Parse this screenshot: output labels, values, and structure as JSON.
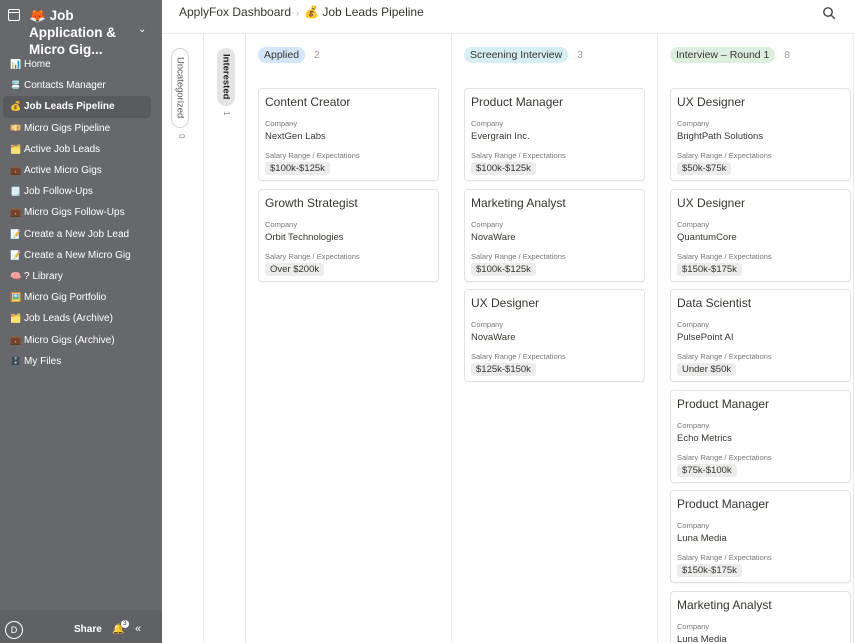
{
  "sidebar": {
    "title_icon": "🦊",
    "title": "Job Application & Micro Gig...",
    "items": [
      {
        "emoji": "📊",
        "label": "Home"
      },
      {
        "emoji": "📇",
        "label": "Contacts Manager"
      },
      {
        "emoji": "💰",
        "label": "Job Leads Pipeline"
      },
      {
        "emoji": "💴",
        "label": "Micro Gigs Pipeline"
      },
      {
        "emoji": "🗂️",
        "label": "Active Job Leads"
      },
      {
        "emoji": "💼",
        "label": "Active Micro Gigs"
      },
      {
        "emoji": "🗒️",
        "label": "Job Follow-Ups"
      },
      {
        "emoji": "💼",
        "label": "Micro Gigs Follow-Ups"
      },
      {
        "emoji": "📝",
        "label": "Create a New Job Lead"
      },
      {
        "emoji": "📝",
        "label": "Create a New Micro Gig"
      },
      {
        "emoji": "🧠",
        "label": "? Library"
      },
      {
        "emoji": "🖼️",
        "label": "Micro Gig Portfolio"
      },
      {
        "emoji": "🗂️",
        "label": "Job Leads (Archive)"
      },
      {
        "emoji": "💼",
        "label": "Micro Gigs (Archive)"
      },
      {
        "emoji": "🗄️",
        "label": "My Files"
      }
    ],
    "footer": {
      "avatar": "D",
      "share": "Share",
      "notifications": "3"
    }
  },
  "topbar": {
    "breadcrumb_root": "ApplyFox Dashboard",
    "breadcrumb_icon": "💰",
    "breadcrumb_current": "Job Leads Pipeline"
  },
  "collapsed_columns": [
    {
      "label": "Uncategorized",
      "count": "0"
    },
    {
      "label": "Interested",
      "count": "1"
    }
  ],
  "columns": [
    {
      "label": "Applied",
      "count": "2",
      "color": "#d3e5fb",
      "cards": [
        {
          "title": "Content Creator",
          "company_label": "Company",
          "company": "NextGen Labs",
          "salary_label": "Salary Range / Expectations",
          "salary": "$100k-$125k"
        },
        {
          "title": "Growth Strategist",
          "company_label": "Company",
          "company": "Orbit Technologies",
          "salary_label": "Salary Range / Expectations",
          "salary": "Over $200k"
        }
      ]
    },
    {
      "label": "Screening Interview",
      "count": "3",
      "color": "#d5eef3",
      "cards": [
        {
          "title": "Product Manager",
          "company_label": "Company",
          "company": "Evergrain Inc.",
          "salary_label": "Salary Range / Expectations",
          "salary": "$100k-$125k"
        },
        {
          "title": "Marketing Analyst",
          "company_label": "Company",
          "company": "NovaWare",
          "salary_label": "Salary Range / Expectations",
          "salary": "$100k-$125k"
        },
        {
          "title": "UX Designer",
          "company_label": "Company",
          "company": "NovaWare",
          "salary_label": "Salary Range / Expectations",
          "salary": "$125k-$150k"
        }
      ]
    },
    {
      "label": "Interview – Round 1",
      "count": "8",
      "color": "#dcefdc",
      "cards": [
        {
          "title": "UX Designer",
          "company_label": "Company",
          "company": "BrightPath Solutions",
          "salary_label": "Salary Range / Expectations",
          "salary": "$50k-$75k"
        },
        {
          "title": "UX Designer",
          "company_label": "Company",
          "company": "QuantumCore",
          "salary_label": "Salary Range / Expectations",
          "salary": "$150k-$175k"
        },
        {
          "title": "Data Scientist",
          "company_label": "Company",
          "company": "PulsePoint AI",
          "salary_label": "Salary Range / Expectations",
          "salary": "Under $50k"
        },
        {
          "title": "Product Manager",
          "company_label": "Company",
          "company": "Echo Metrics",
          "salary_label": "Salary Range / Expectations",
          "salary": "$75k-$100k"
        },
        {
          "title": "Product Manager",
          "company_label": "Company",
          "company": "Luna Media",
          "salary_label": "Salary Range / Expectations",
          "salary": "$150k-$175k"
        },
        {
          "title": "Marketing Analyst",
          "company_label": "Company",
          "company": "Luna Media",
          "salary_label": "",
          "salary": ""
        }
      ]
    }
  ]
}
